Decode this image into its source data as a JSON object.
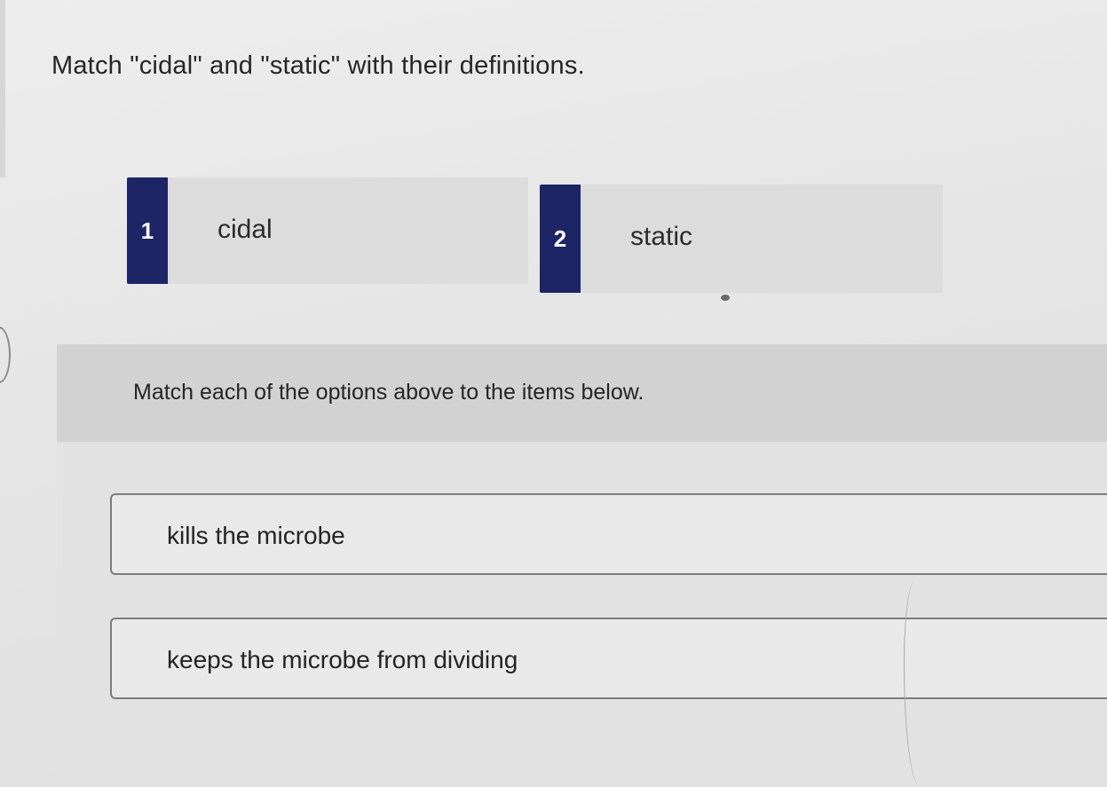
{
  "question": {
    "text": "Match \"cidal\" and \"static\" with their definitions."
  },
  "options": [
    {
      "number": "1",
      "label": "cidal"
    },
    {
      "number": "2",
      "label": "static"
    }
  ],
  "instructions": {
    "text": "Match each of the options above to the items below."
  },
  "targets": [
    {
      "label": "kills the microbe"
    },
    {
      "label": "keeps the microbe from dividing"
    }
  ],
  "colors": {
    "number_tab": "#1d2566",
    "option_card": "#dcdcdc",
    "instructions_band": "#d2d2d2"
  }
}
